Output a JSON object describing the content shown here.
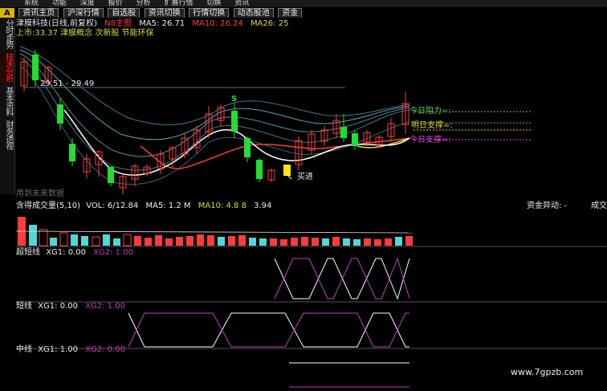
{
  "menubar": {
    "items": [
      "系统",
      "功能",
      "深度",
      "报价",
      "分析",
      "扩展行情",
      "切换",
      "资讯"
    ]
  },
  "tabs": [
    {
      "label": "A",
      "active": true
    },
    {
      "label": "资讯主页"
    },
    {
      "label": "沪深行情"
    },
    {
      "label": "自选股"
    },
    {
      "label": "资讯切换"
    },
    {
      "label": "行情切换"
    },
    {
      "label": "动态股池"
    },
    {
      "label": "资金"
    }
  ],
  "side_tabs": [
    {
      "label": "分时走势",
      "active": false
    },
    {
      "label": "技术分析",
      "active": true
    },
    {
      "label": "基本资料",
      "active": false
    },
    {
      "label": "财务透视",
      "active": false
    }
  ],
  "main_chart": {
    "stock_title": "津膜科技(日线,前复权)",
    "overlay_label": "N8主图",
    "ma5": "MA5: 26.71",
    "ma10": "MA10: 26.24",
    "ma26": "MA26: 25",
    "sub_info": "上市:33.37 津膜概念 次新股 节能环保",
    "price_range": "29.51 - 29.49",
    "tomorrow_resistance": "今日阻力=:",
    "tomorrow_support": "明日支撑=:",
    "today_support": "今日支撑=:",
    "sell_marker": "S",
    "buy_marker": "买进",
    "future_data": "用到未来数据",
    "colors": {
      "up": "#ff3c3c",
      "down": "#22dd33",
      "ma5": "#ffffff",
      "ma10": "#ff3c3c",
      "ma26": "#d8d83a",
      "bands": "#4a8a9a",
      "resist": "#5ec85e",
      "support": "#cc44cc"
    }
  },
  "volume_panel": {
    "header": "含得成交量(5,10)",
    "vol_text": "VOL: 6/12.84",
    "ma_text": "MA5: 1.2 M",
    "ma10_text": "MA10: 4.8 8",
    "cap_text": "资金异动: -",
    "flow_text": "成交",
    "extra_num": "3.94"
  },
  "indicator_panels": [
    {
      "name": "超短线",
      "xg1": "XG1: 0.00",
      "xg2": "XG2: 1.00"
    },
    {
      "name": "短线",
      "xg1": "XG1: 0.00",
      "xg2": "XG2: 1.00"
    },
    {
      "name": "中线",
      "xg1": "XG1: 1.00",
      "xg2": "XG2: 0.00"
    }
  ],
  "watermark": "www.7gpzb.com"
}
